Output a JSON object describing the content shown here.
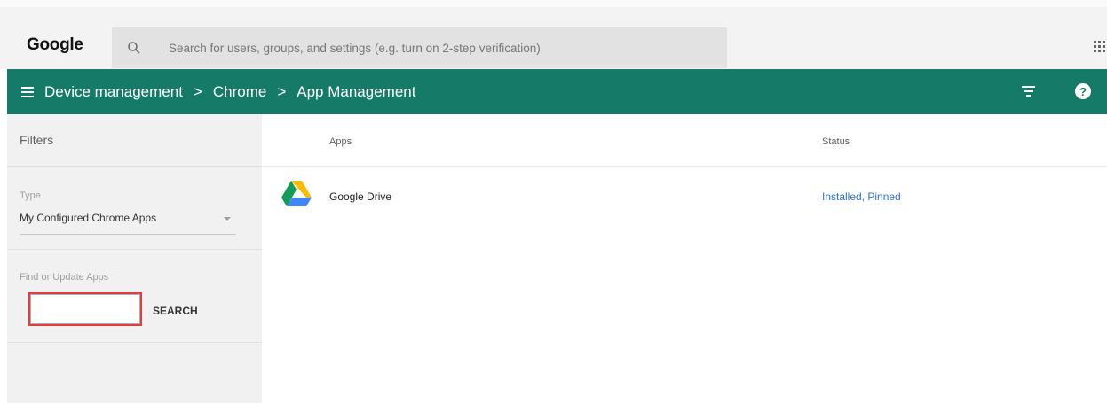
{
  "header": {
    "logo": "Google",
    "search_placeholder": "Search for users, groups, and settings (e.g. turn on 2-step verification)"
  },
  "appbar": {
    "breadcrumbs": [
      "Device management",
      "Chrome",
      "App Management"
    ],
    "separator": ">"
  },
  "sidebar": {
    "title": "Filters",
    "type_label": "Type",
    "type_value": "My Configured Chrome Apps",
    "find_label": "Find or Update Apps",
    "search_button": "SEARCH",
    "find_input_value": ""
  },
  "table": {
    "columns": [
      "Apps",
      "Status"
    ],
    "rows": [
      {
        "icon": "google-drive-icon",
        "name": "Google Drive",
        "status": "Installed, Pinned"
      }
    ]
  },
  "colors": {
    "appbar": "#167a68",
    "status_link": "#2a73d9",
    "highlight": "#e43c3c"
  }
}
